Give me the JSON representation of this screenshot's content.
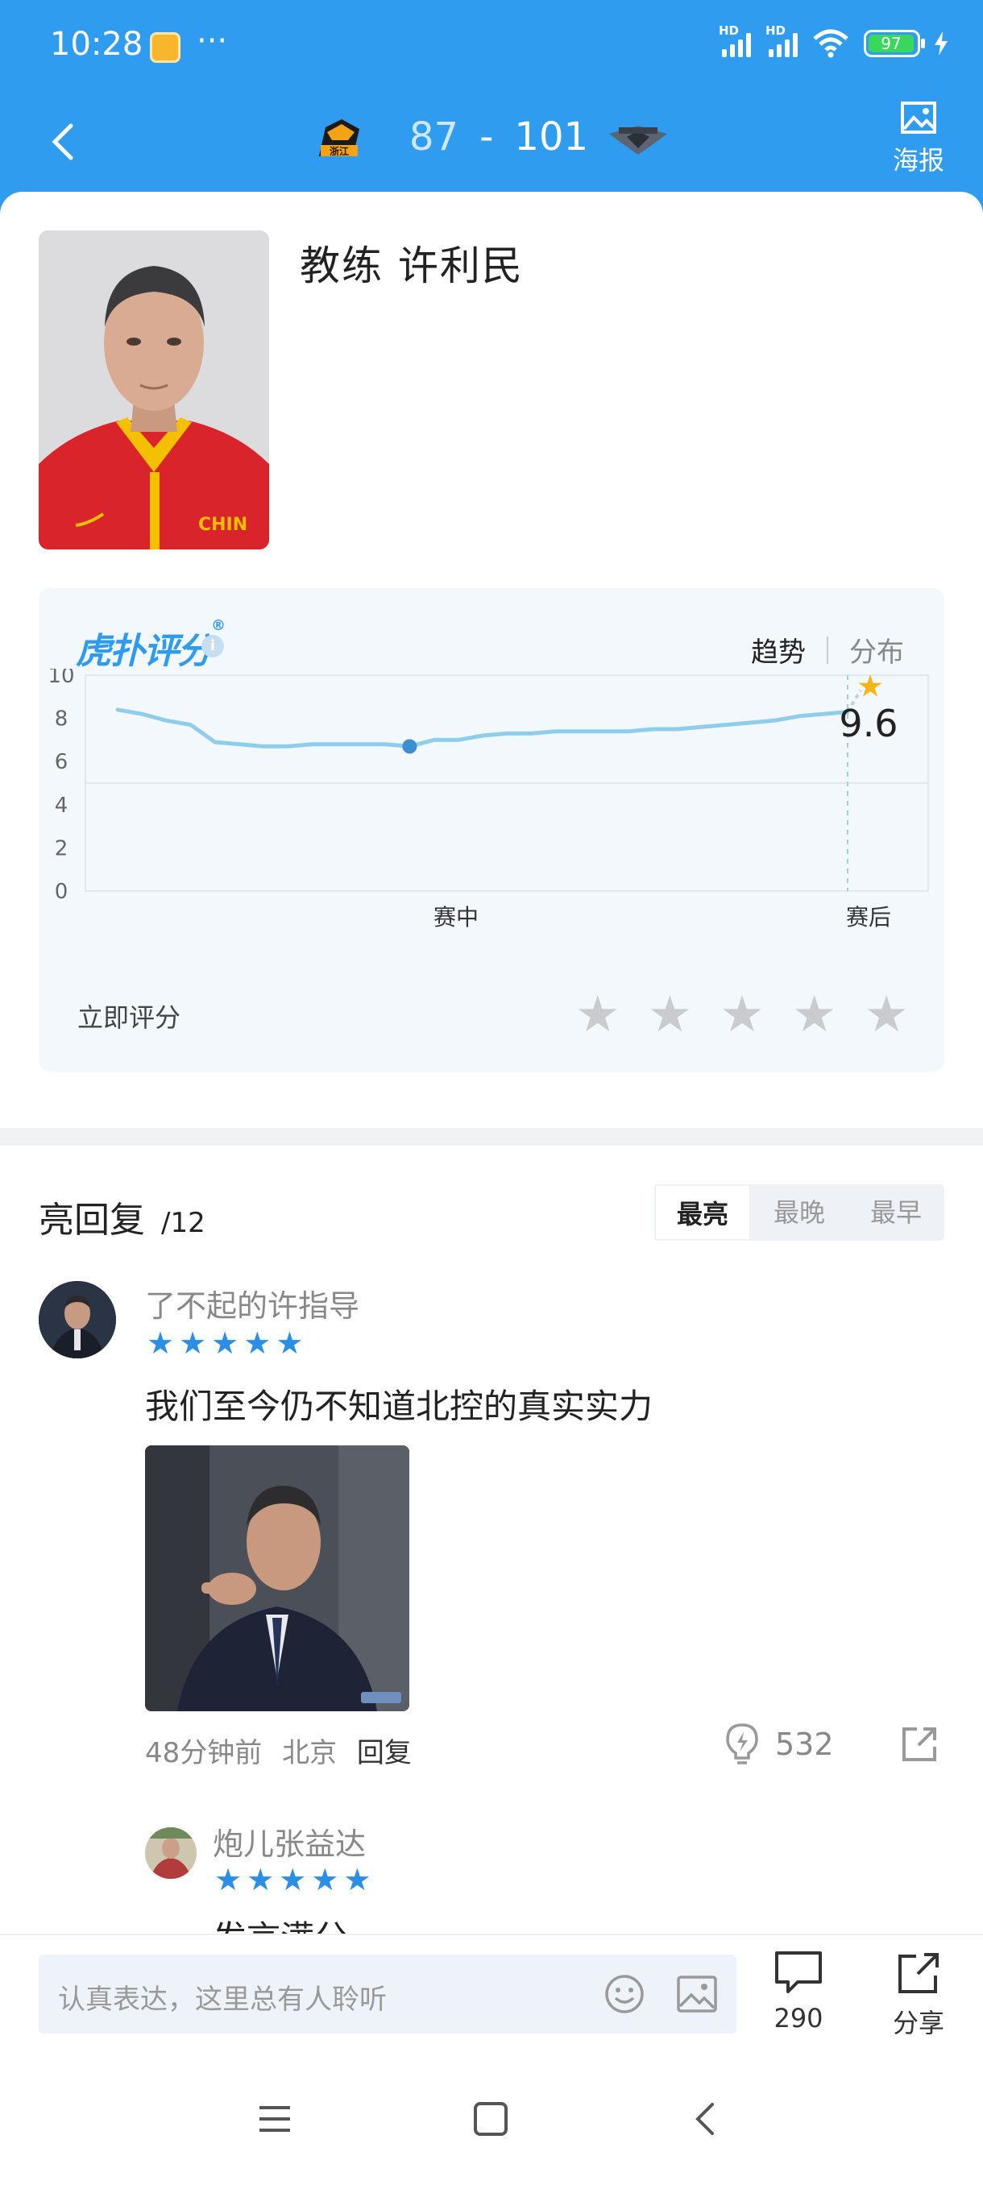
{
  "status_bar": {
    "time": "10:28",
    "dots": "···",
    "battery": "97",
    "network_tag": "HD"
  },
  "header": {
    "home_score": "87",
    "separator": "-",
    "away_score": "101",
    "poster_label": "海报"
  },
  "coach": {
    "title": "教练 许利民"
  },
  "rating": {
    "brand": "虎扑评分",
    "brand_mark": "®",
    "info_glyph": "i",
    "tab_trend": "趋势",
    "tab_distribution": "分布",
    "final_score": "9.6",
    "rate_prompt": "立即评分"
  },
  "chart_data": {
    "type": "line",
    "x_labels": [
      "赛中",
      "赛后"
    ],
    "yticks": [
      "10",
      "8",
      "6",
      "4",
      "2",
      "0"
    ],
    "ylim": [
      0,
      10
    ],
    "series": [
      {
        "values": [
          8.4,
          8.2,
          7.9,
          7.7,
          6.9,
          6.8,
          6.7,
          6.7,
          6.8,
          6.8,
          6.8,
          6.8,
          6.7,
          7.0,
          7.0,
          7.2,
          7.3,
          7.3,
          7.4,
          7.4,
          7.4,
          7.4,
          7.5,
          7.5,
          7.6,
          7.7,
          7.8,
          7.9,
          8.1,
          8.2,
          8.3
        ]
      }
    ],
    "highlight_index": 12,
    "post_game_value": 9.6,
    "grid": true
  },
  "replies": {
    "title": "亮回复",
    "count": "/12",
    "sort_tabs": [
      "最亮",
      "最晚",
      "最早"
    ],
    "items": [
      {
        "user": "了不起的许指导",
        "stars": 5,
        "text": "我们至今仍不知道北控的真实实力",
        "time": "48分钟前",
        "location": "北京",
        "reply_label": "回复",
        "likes": "532"
      }
    ],
    "sub_reply": {
      "user": "炮儿张益达",
      "stars": 5,
      "text": "发言满分"
    }
  },
  "bottom_bar": {
    "placeholder": "认真表达，这里总有人聆听",
    "comment_count": "290",
    "share_label": "分享"
  },
  "colors": {
    "brand_blue": "#2f9cf0",
    "star_blue": "#2b8fe6",
    "line_blue": "#8fcdee",
    "gold_star": "#f5b418"
  }
}
